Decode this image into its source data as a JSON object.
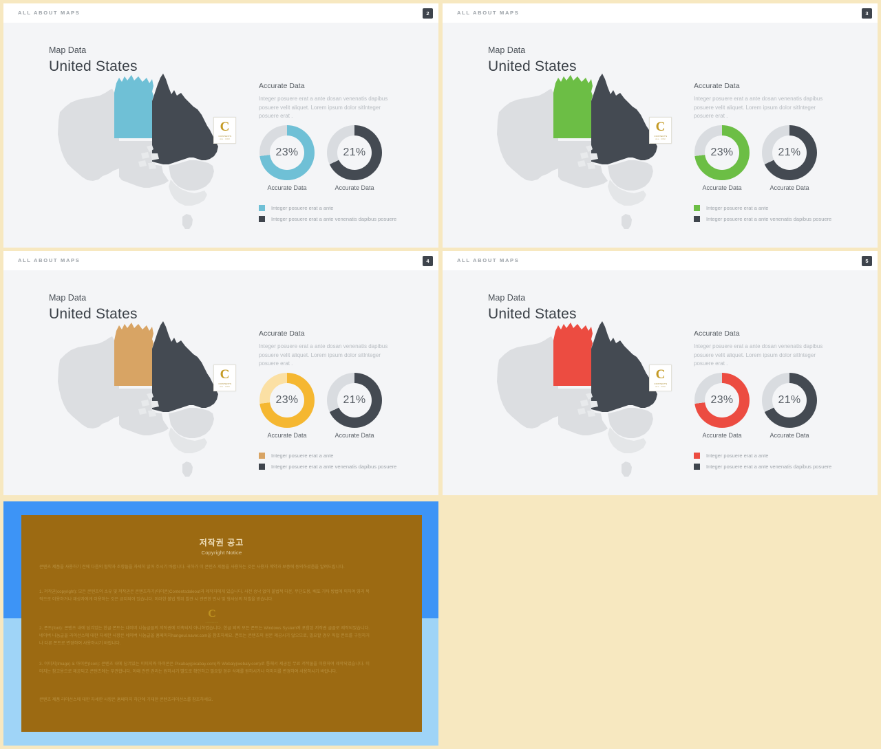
{
  "meta": {
    "background_color": "#f7e8c0",
    "slide_background": "#f4f5f7",
    "dark_color": "#444a52",
    "track_color": "#d9dce0"
  },
  "slides": [
    {
      "id": "slide-2",
      "header_title": "ALL ABOUT MAPS",
      "page_number": "2",
      "kicker": "Map Data",
      "headline": "United States",
      "panel_title": "Accurate Data",
      "panel_body": "Integer posuere erat a ante dosan venenatis dapibus posuere velit aliquet. Lorem ipsum dolor sitInteger posuere erat .",
      "accent_color": "#6fc0d6",
      "accent_track": "#d9dce0",
      "map_highlight_color": "#6fc0d6",
      "donuts": [
        {
          "value": 23,
          "label": "23%",
          "caption": "Accurate Data",
          "color": "#6fc0d6",
          "track": "#d9dce0",
          "fill_fraction": 0.73
        },
        {
          "value": 21,
          "label": "21%",
          "caption": "Accurate Data",
          "color": "#444a52",
          "track": "#d9dce0",
          "fill_fraction": 0.68
        }
      ],
      "legend": [
        {
          "color": "#6fc0d6",
          "text": "Integer posuere erat a ante"
        },
        {
          "color": "#3f454d",
          "text": "Integer posuere erat a ante venenatis dapibus posuere"
        }
      ]
    },
    {
      "id": "slide-3",
      "header_title": "ALL ABOUT MAPS",
      "page_number": "3",
      "kicker": "Map Data",
      "headline": "United States",
      "panel_title": "Accurate Data",
      "panel_body": "Integer posuere erat a ante dosan venenatis dapibus posuere velit aliquet. Lorem ipsum dolor sitInteger posuere erat .",
      "accent_color": "#6cbe45",
      "accent_track": "#d9dce0",
      "map_highlight_color": "#6cbe45",
      "donuts": [
        {
          "value": 23,
          "label": "23%",
          "caption": "Accurate Data",
          "color": "#6cbe45",
          "track": "#d9dce0",
          "fill_fraction": 0.73
        },
        {
          "value": 21,
          "label": "21%",
          "caption": "Accurate Data",
          "color": "#444a52",
          "track": "#d9dce0",
          "fill_fraction": 0.68
        }
      ],
      "legend": [
        {
          "color": "#6cbe45",
          "text": "Integer posuere erat a ante"
        },
        {
          "color": "#3f454d",
          "text": "Integer posuere erat a ante venenatis dapibus posuere"
        }
      ]
    },
    {
      "id": "slide-4",
      "header_title": "ALL ABOUT MAPS",
      "page_number": "4",
      "kicker": "Map Data",
      "headline": "United States",
      "panel_title": "Accurate Data",
      "panel_body": "Integer posuere erat a ante dosan venenatis dapibus posuere velit aliquet. Lorem ipsum dolor sitInteger posuere erat .",
      "accent_color": "#f5b731",
      "accent_track": "#fbe0a4",
      "map_highlight_color": "#d8a464",
      "donuts": [
        {
          "value": 23,
          "label": "23%",
          "caption": "Accurate Data",
          "color": "#f5b731",
          "track": "#fbe0a4",
          "fill_fraction": 0.73
        },
        {
          "value": 21,
          "label": "21%",
          "caption": "Accurate Data",
          "color": "#444a52",
          "track": "#d9dce0",
          "fill_fraction": 0.68
        }
      ],
      "legend": [
        {
          "color": "#d8a464",
          "text": "Integer posuere erat a ante"
        },
        {
          "color": "#3f454d",
          "text": "Integer posuere erat a ante venenatis dapibus posuere"
        }
      ]
    },
    {
      "id": "slide-5",
      "header_title": "ALL ABOUT MAPS",
      "page_number": "5",
      "kicker": "Map Data",
      "headline": "United States",
      "panel_title": "Accurate Data",
      "panel_body": "Integer posuere erat a ante dosan venenatis dapibus posuere velit aliquet. Lorem ipsum dolor sitInteger posuere erat .",
      "accent_color": "#ec4c41",
      "accent_track": "#d9dce0",
      "map_highlight_color": "#ec4c41",
      "donuts": [
        {
          "value": 23,
          "label": "23%",
          "caption": "Accurate Data",
          "color": "#ec4c41",
          "track": "#d9dce0",
          "fill_fraction": 0.73
        },
        {
          "value": 21,
          "label": "21%",
          "caption": "Accurate Data",
          "color": "#444a52",
          "track": "#d9dce0",
          "fill_fraction": 0.68
        }
      ],
      "legend": [
        {
          "color": "#ec4c41",
          "text": "Integer posuere erat a ante"
        },
        {
          "color": "#3f454d",
          "text": "Integer posuere erat a ante venenatis dapibus posuere"
        }
      ]
    }
  ],
  "logo": {
    "letter": "C",
    "wordmark": "CONTENTS",
    "subline": "ALL . COM"
  },
  "copyright_slide": {
    "heading_ko": "저작권 공고",
    "heading_en": "Copyright Notice",
    "intro": "콘텐츠 제품을 사용하기 전에 다음의 협약과 조항들을 자세히 읽어 주시기 바랍니다. 귀하가 이 콘텐츠 제품을 사용하는 것은 사용자 계약과 보증에 동의하셨음을 알려드립니다.",
    "clause_1": "1. 저작권(copyright): 모든 콘텐츠의 소유 및 저작권은 콘텐츠하기(아이콘)Contentsdaleout과 제작자에게 있습니다. 사전 승낙 없이 불법적 다운, 무단도용, 배포 기타 방법에 의하여 영리 목적으로 이용하거나 재상자에게 이용하는 것은 금지되어 있습니다. 이러한 불법 행위 발견 시 관련한 민사 및 형사상의 처벌을 받습니다.",
    "clause_2": "2. 폰트(font): 콘텐츠 내에 담겨있는 한글 폰트는 네이버 나눔글꼴의 저작권에 저촉되지 아니하였습니다. 한글 외의 모든 폰트는 Windows System에 포함된 저작권 글꼴로 제작되었습니다. 네이버 나눔글꼴 라이선스에 대한 자세한 사항은 네이버 나눔글꼴 홈페이지hangeul.naver.com을 참조하세요. 폰트는 콘텐츠의 원본 제공시기 않으므로, 필요할 경우 직접 폰트를 구입하거나 다른 폰트로 변경하여 사용하시기 바랍니다.",
    "clause_3": "3. 이미지(Image) & 아이콘(Icon): 콘텐츠 내에 담겨있는 이미지와 아이콘은 Pixabay(pixabay.com)와 Webaly(webaly.com)로 통해서 제공된 무료 저작물을 이용하여 제작되었습니다. 이미지는 참고용으로 제공되고 콘텐츠에는 무관합니다. 이때 관련 권리는 원하시기 별도로 확인하고 필요할 경우 삭제를 원하시거나 이미지를 변경하여 사용하시기 바랍니다.",
    "footer": "콘텐츠 제품 라이선스에 대한 자세한 사항은 홈페이지 하단에 기재한 콘텐츠라이선스를 참조하세요."
  }
}
